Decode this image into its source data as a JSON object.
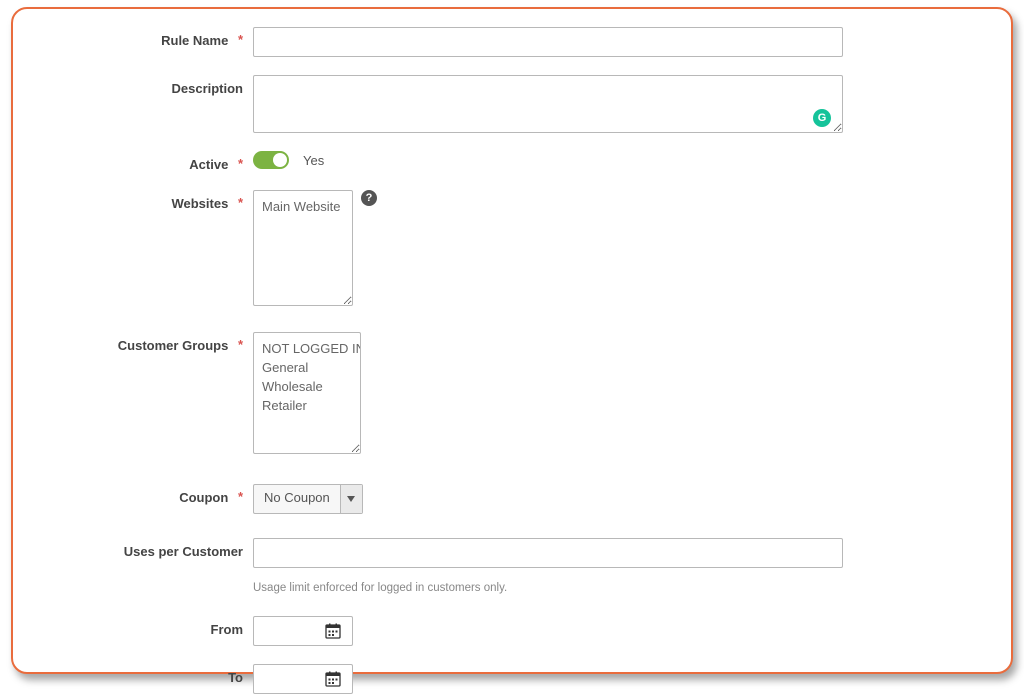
{
  "labels": {
    "rule_name": "Rule Name",
    "description": "Description",
    "active": "Active",
    "websites": "Websites",
    "customer_groups": "Customer Groups",
    "coupon": "Coupon",
    "uses_per_customer": "Uses per Customer",
    "from": "From",
    "to": "To"
  },
  "values": {
    "rule_name": "",
    "description": "",
    "active_label": "Yes",
    "uses_per_customer": "",
    "from": "",
    "to": ""
  },
  "websites": {
    "options": [
      "Main Website"
    ]
  },
  "customer_groups": {
    "options": [
      "NOT LOGGED IN",
      "General",
      "Wholesale",
      "Retailer"
    ]
  },
  "coupon": {
    "selected": "No Coupon"
  },
  "hints": {
    "uses_per_customer": "Usage limit enforced for logged in customers only."
  },
  "required_marker": "*"
}
